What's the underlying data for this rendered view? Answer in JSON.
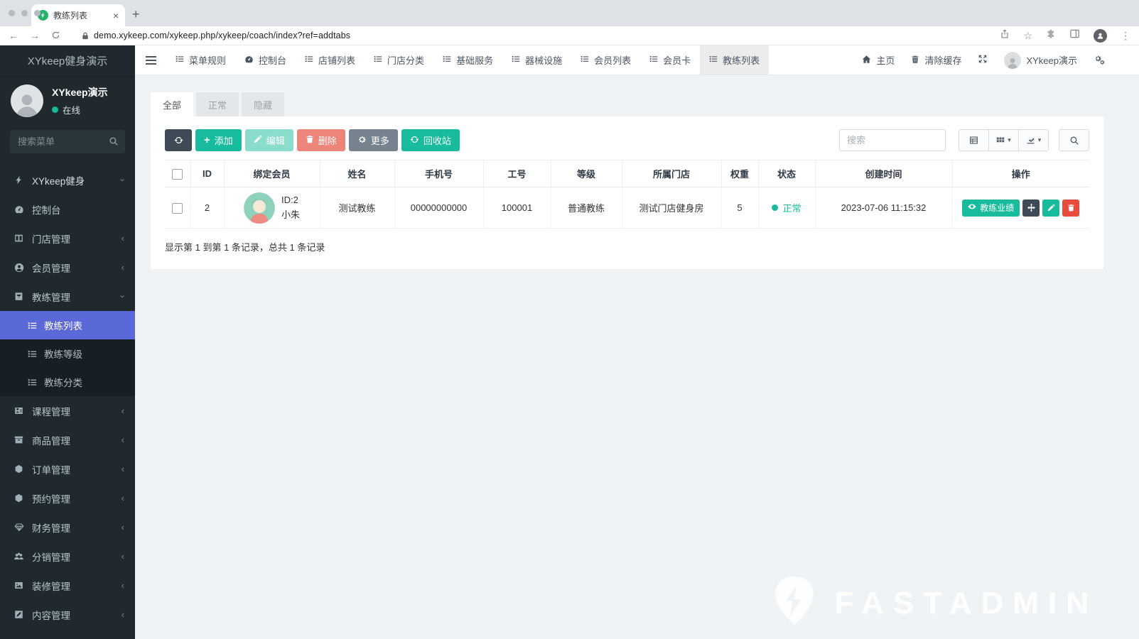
{
  "browser": {
    "tab_title": "教练列表",
    "url": "demo.xykeep.com/xykeep.php/xykeep/coach/index?ref=addtabs"
  },
  "icons": {
    "close": "×",
    "new_tab": "+",
    "back": "←",
    "forward": "→",
    "star": "☆",
    "menu_dots": "⋮",
    "caret_down": "▾",
    "chevron_collapsed": "‹",
    "chevron_expanded": "›",
    "plus": "+"
  },
  "topbar": {
    "tabs": [
      {
        "label": "菜单规则"
      },
      {
        "label": "控制台"
      },
      {
        "label": "店铺列表"
      },
      {
        "label": "门店分类"
      },
      {
        "label": "基础服务"
      },
      {
        "label": "器械设施"
      },
      {
        "label": "会员列表"
      },
      {
        "label": "会员卡"
      },
      {
        "label": "教练列表"
      }
    ],
    "home": "主页",
    "clear_cache": "清除缓存",
    "username": "XYkeep演示"
  },
  "sidebar": {
    "brand": "XYkeep健身演示",
    "user": {
      "name": "XYkeep演示",
      "status": "在线"
    },
    "search_placeholder": "搜索菜单",
    "menu": [
      {
        "label": "XYkeep健身"
      },
      {
        "label": "控制台"
      },
      {
        "label": "门店管理"
      },
      {
        "label": "会员管理"
      },
      {
        "label": "教练管理"
      },
      {
        "label": "课程管理"
      },
      {
        "label": "商品管理"
      },
      {
        "label": "订单管理"
      },
      {
        "label": "预约管理"
      },
      {
        "label": "财务管理"
      },
      {
        "label": "分销管理"
      },
      {
        "label": "装修管理"
      },
      {
        "label": "内容管理"
      }
    ],
    "submenu": [
      {
        "label": "教练列表"
      },
      {
        "label": "教练等级"
      },
      {
        "label": "教练分类"
      }
    ]
  },
  "content": {
    "tabs": [
      {
        "label": "全部"
      },
      {
        "label": "正常"
      },
      {
        "label": "隐藏"
      }
    ],
    "toolbar": {
      "add": "添加",
      "edit": "编辑",
      "delete": "删除",
      "more": "更多",
      "recycle": "回收站",
      "search_placeholder": "搜索"
    },
    "table": {
      "headers": [
        "ID",
        "绑定会员",
        "姓名",
        "手机号",
        "工号",
        "等级",
        "所属门店",
        "权重",
        "状态",
        "创建时间",
        "操作"
      ],
      "row": {
        "id": "2",
        "member_id": "ID:2",
        "member_name": "小朱",
        "name": "测试教练",
        "phone": "00000000000",
        "job_no": "100001",
        "level": "普通教练",
        "store": "测试门店健身房",
        "weight": "5",
        "status": "正常",
        "created_at": "2023-07-06 11:15:32",
        "performance": "教练业绩"
      }
    },
    "summary": "显示第 1 到第 1 条记录，总共 1 条记录"
  },
  "watermark": "FASTADMIN",
  "colors": {
    "accent_green": "#18bc9c",
    "active_menu_blue": "#5a69d7",
    "danger_red": "#e74c3c",
    "dark_button": "#3e4a56",
    "sidebar_bg": "#1f292e",
    "content_bg": "#f0f3f6"
  }
}
